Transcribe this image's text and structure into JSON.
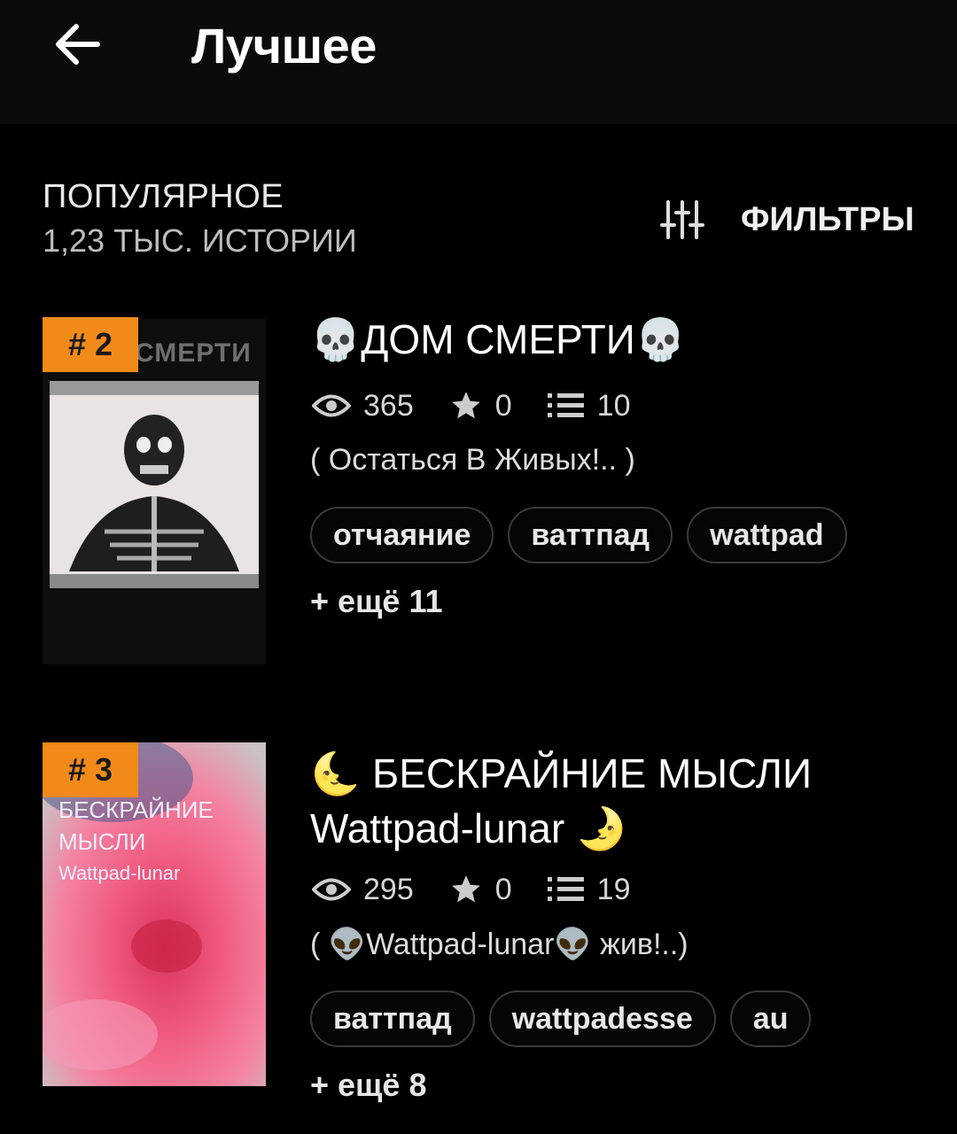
{
  "header": {
    "title": "Лучшее"
  },
  "section": {
    "title": "ПОПУЛЯРНОЕ",
    "count": "1,23 ТЫС. ИСТОРИИ",
    "filters_label": "ФИЛЬТРЫ"
  },
  "stories": [
    {
      "rank": "# 2",
      "title": "💀ДОМ СМЕРТИ💀",
      "cover_text": "СМЕРТИ",
      "views": "365",
      "votes": "0",
      "parts": "10",
      "description": "(  Остаться В Живых!.. )",
      "tags": [
        "отчаяние",
        "ваттпад",
        "wattpad"
      ],
      "more": "+ ещё 11"
    },
    {
      "rank": "# 3",
      "title_line1": "🌜 БЕСКРАЙНИЕ МЫСЛИ",
      "title_line2": "Wattpad-lunar 🌛",
      "cover_line1": "БЕСКРАЙНИЕ",
      "cover_line2": "МЫСЛИ",
      "cover_line3": "Wattpad-lunar",
      "views": "295",
      "votes": "0",
      "parts": "19",
      "description": "( 👽Wattpad-lunar👽 жив!..)",
      "tags": [
        "ваттпад",
        "wattpadesse",
        "au"
      ],
      "more": "+ ещё 8"
    }
  ],
  "colors": {
    "background": "#000000",
    "badge": "#f28a1a",
    "text": "#ffffff",
    "tag_border": "#3a3a3a"
  }
}
